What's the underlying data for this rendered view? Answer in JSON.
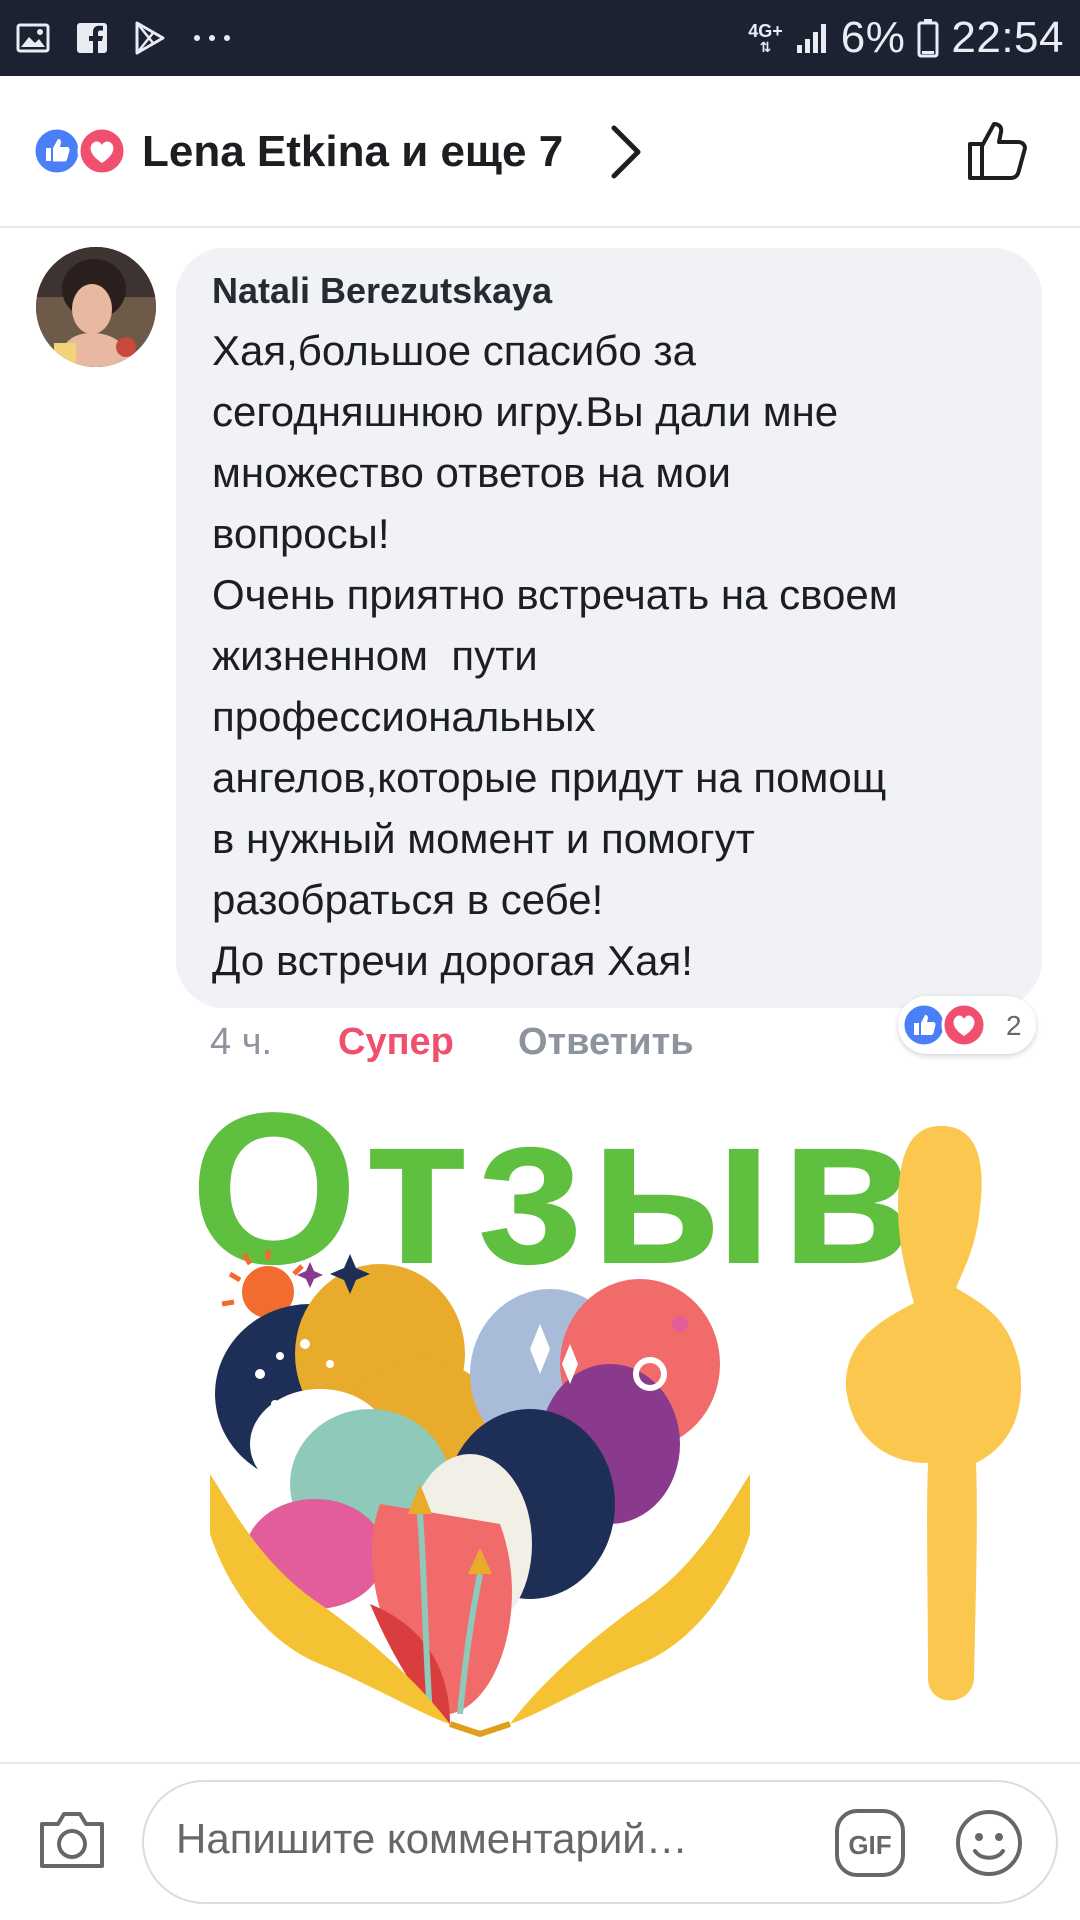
{
  "status_bar": {
    "network": "4G+",
    "battery": "6%",
    "time": "22:54",
    "left_icons": [
      "gallery-icon",
      "facebook-icon",
      "play-store-icon",
      "more-dots-icon"
    ],
    "right_icons": [
      "signal-icon",
      "battery-icon"
    ]
  },
  "reactions_header": {
    "text": "Lena Etkina и еще 7",
    "icons": [
      "like-reaction-icon",
      "love-reaction-icon",
      "chevron-right-icon",
      "thumbs-up-outline-icon"
    ]
  },
  "comment": {
    "author": "Natali Berezutskaya",
    "lines": [
      "Хая,большое спасибо за",
      "сегодняшнюю игру.Вы дали мне",
      "множество ответов на мои",
      "вопросы!",
      "Очень приятно встречать на своем",
      "жизненном  пути",
      "профессиональных",
      "ангелов,которые придут на помощ",
      "в нужный момент и помогут",
      "разобраться в себе!",
      "До встречи дорогая Хая!"
    ],
    "time": "4 ч.",
    "reaction_label": "Супер",
    "reply_label": "Ответить",
    "reaction_count": "2"
  },
  "image": {
    "word": "Отзыв",
    "word_color": "#5fbf3f",
    "arrow_color": "#fcc74f"
  },
  "composer": {
    "placeholder": "Напишите комментарий…",
    "gif_label": "GIF",
    "icons": [
      "camera-icon",
      "gif-icon",
      "emoji-icon"
    ]
  },
  "colors": {
    "status_bar_bg": "#1c2232",
    "bubble_bg": "#f0f2f5",
    "like_blue": "#4a7ff7",
    "love_red": "#f0506e"
  }
}
